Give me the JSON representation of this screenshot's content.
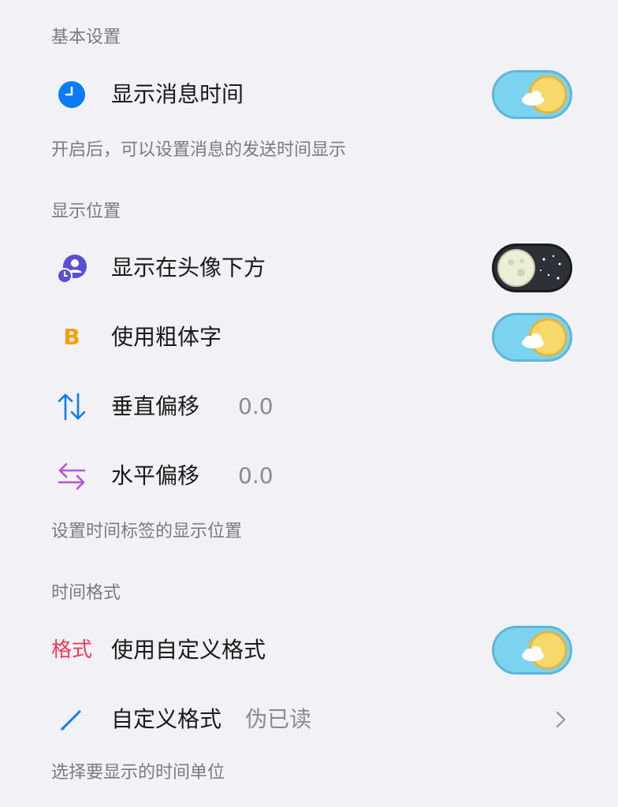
{
  "sections": {
    "basic": {
      "header": "基本设置",
      "show_time_label": "显示消息时间",
      "show_time_on": true,
      "desc": "开启后，可以设置消息的发送时间显示"
    },
    "position": {
      "header": "显示位置",
      "below_avatar_label": "显示在头像下方",
      "below_avatar_on": false,
      "bold_label": "使用粗体字",
      "bold_on": true,
      "bold_icon_text": "B",
      "vertical_label": "垂直偏移",
      "vertical_value": "0.0",
      "horizontal_label": "水平偏移",
      "horizontal_value": "0.0",
      "desc": "设置时间标签的显示位置"
    },
    "format": {
      "header": "时间格式",
      "format_icon_text": "格式",
      "custom_format_toggle_label": "使用自定义格式",
      "custom_format_on": true,
      "custom_format_label": "自定义格式",
      "custom_format_value": "伪已读",
      "desc": "选择要显示的时间单位"
    }
  },
  "colors": {
    "background": "#F2F1F6",
    "clock_icon": "#0A7CF5",
    "avatar_icon": "#5B4FD1",
    "bold_icon": "#F5A00A",
    "vertical_icon": "#0A7CF5",
    "horizontal_icon": "#B455E0",
    "format_icon": "#F03A5A",
    "edit_icon": "#0A7CF5"
  },
  "icons": {
    "clock": "clock-icon",
    "avatar": "avatar-below-icon",
    "bold": "bold-icon",
    "vertical": "vertical-offset-icon",
    "horizontal": "horizontal-offset-icon",
    "format": "format-icon",
    "edit": "pencil-icon",
    "chevron": "chevron-right-icon"
  }
}
